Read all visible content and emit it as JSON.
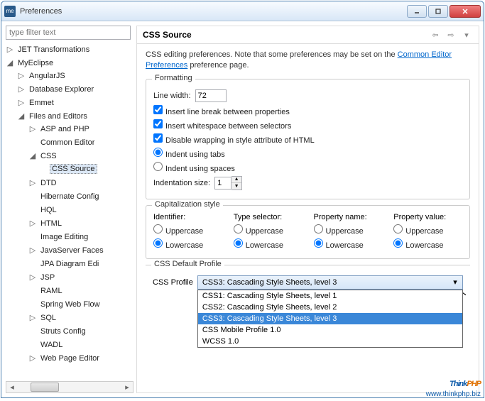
{
  "window": {
    "title": "Preferences",
    "app_icon": "me"
  },
  "filter_placeholder": "type filter text",
  "tree": {
    "jet": "JET Transformations",
    "myeclipse": "MyEclipse",
    "angular": "AngularJS",
    "dbexplorer": "Database Explorer",
    "emmet": "Emmet",
    "files_editors": "Files and Editors",
    "asp_php": "ASP and PHP",
    "common_editor": "Common Editor",
    "css": "CSS",
    "css_source": "CSS Source",
    "dtd": "DTD",
    "hibernate": "Hibernate Config",
    "hql": "HQL",
    "html": "HTML",
    "image_editing": "Image Editing",
    "jsf": "JavaServer Faces",
    "jpa": "JPA Diagram Edi",
    "jsp": "JSP",
    "raml": "RAML",
    "spring": "Spring Web Flow",
    "sql": "SQL",
    "struts": "Struts Config",
    "wadl": "WADL",
    "webpage": "Web Page Editor"
  },
  "page": {
    "title": "CSS Source",
    "desc_prefix": "CSS editing preferences.  Note that some preferences may be set on the ",
    "desc_link": "Common Editor Preferences",
    "desc_suffix": " preference page."
  },
  "formatting": {
    "title": "Formatting",
    "line_width_label": "Line width:",
    "line_width_value": "72",
    "cb_linebreak": "Insert line break between properties",
    "cb_whitespace": "Insert whitespace between selectors",
    "cb_wrapping": "Disable wrapping in style attribute of HTML",
    "rb_tabs": "Indent using tabs",
    "rb_spaces": "Indent using spaces",
    "indent_size_label": "Indentation size:",
    "indent_size_value": "1"
  },
  "capitalization": {
    "title": "Capitalization style",
    "identifier": "Identifier:",
    "type_selector": "Type selector:",
    "property_name": "Property name:",
    "property_value": "Property value:",
    "upper": "Uppercase",
    "lower": "Lowercase"
  },
  "profile": {
    "group_title": "CSS Default Profile",
    "label": "CSS Profile",
    "selected": "CSS3: Cascading Style Sheets, level 3",
    "options": [
      "CSS1: Cascading Style Sheets, level 1",
      "CSS2: Cascading Style Sheets, level 2",
      "CSS3: Cascading Style Sheets, level 3",
      "CSS Mobile Profile 1.0",
      "WCSS 1.0"
    ]
  },
  "watermark": {
    "t1": "Think",
    "t2": "PHP",
    "url": "www.thinkphp.biz"
  }
}
